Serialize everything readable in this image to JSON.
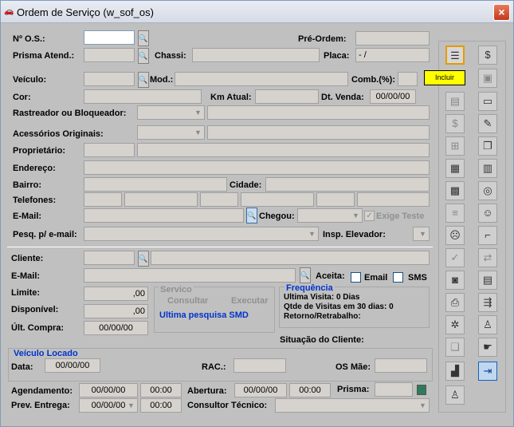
{
  "window": {
    "title": "Ordem de Serviço (w_sof_os)",
    "close": "×",
    "icon": "🚗"
  },
  "labels": {
    "nos": "Nº O.S.:",
    "preordem": "Pré-Ordem:",
    "prisma_atend": "Prisma Atend.:",
    "chassi": "Chassi:",
    "placa": "Placa:",
    "veiculo": "Veículo:",
    "mod": "Mod.:",
    "comb": "Comb.(%):",
    "cor": "Cor:",
    "km_atual": "Km Atual:",
    "dt_venda": "Dt. Venda:",
    "rastreador": "Rastreador ou Bloqueador:",
    "acessorios": "Acessórios Originais:",
    "proprietario": "Proprietário:",
    "endereco": "Endereço:",
    "bairro": "Bairro:",
    "cidade": "Cidade:",
    "telefones": "Telefones:",
    "email": "E-Mail:",
    "chegou": "Chegou:",
    "exige_teste": "Exige Teste",
    "pesq_email": "Pesq. p/ e-mail:",
    "insp_elevador": "Insp. Elevador:",
    "cliente": "Cliente:",
    "email2": "E-Mail:",
    "aceita": "Aceita:",
    "email_cb": "Email",
    "sms_cb": "SMS",
    "limite": "Limite:",
    "disponivel": "Disponível:",
    "ult_compra": "Últ. Compra:",
    "servico": "Servico",
    "consultar": "Consultar",
    "executar": "Executar",
    "ultima_pesquisa": "Ultima pesquisa SMD",
    "frequencia": "Frequência",
    "ultima_visita": "Ultima Visita: 0 Dias",
    "qtde_visitas": "Qtde de Visitas em 30 dias: 0",
    "retorno": "Retorno/Retrabalho:",
    "situacao": "Situação do Cliente:",
    "veiculo_locado": "Veículo Locado",
    "data": "Data:",
    "rac": "RAC.:",
    "os_mae": "OS Mãe:",
    "agendamento": "Agendamento:",
    "abertura": "Abertura:",
    "prisma": "Prisma:",
    "prev_entrega": "Prev. Entrega:",
    "consultor": "Consultor Técnico:"
  },
  "values": {
    "placa": "  -   /",
    "dt_venda": "00/00/00",
    "limite": ",00",
    "disponivel": ",00",
    "ult_compra": "00/00/00",
    "data_locado": "00/00/00",
    "agend_data": "00/00/00",
    "agend_hora": "00:00",
    "abert_data": "00/00/00",
    "abert_hora": "00:00",
    "prev_data": "00/00/00",
    "prev_hora": "00:00"
  },
  "toolbar": {
    "incluir": "Incluir"
  }
}
